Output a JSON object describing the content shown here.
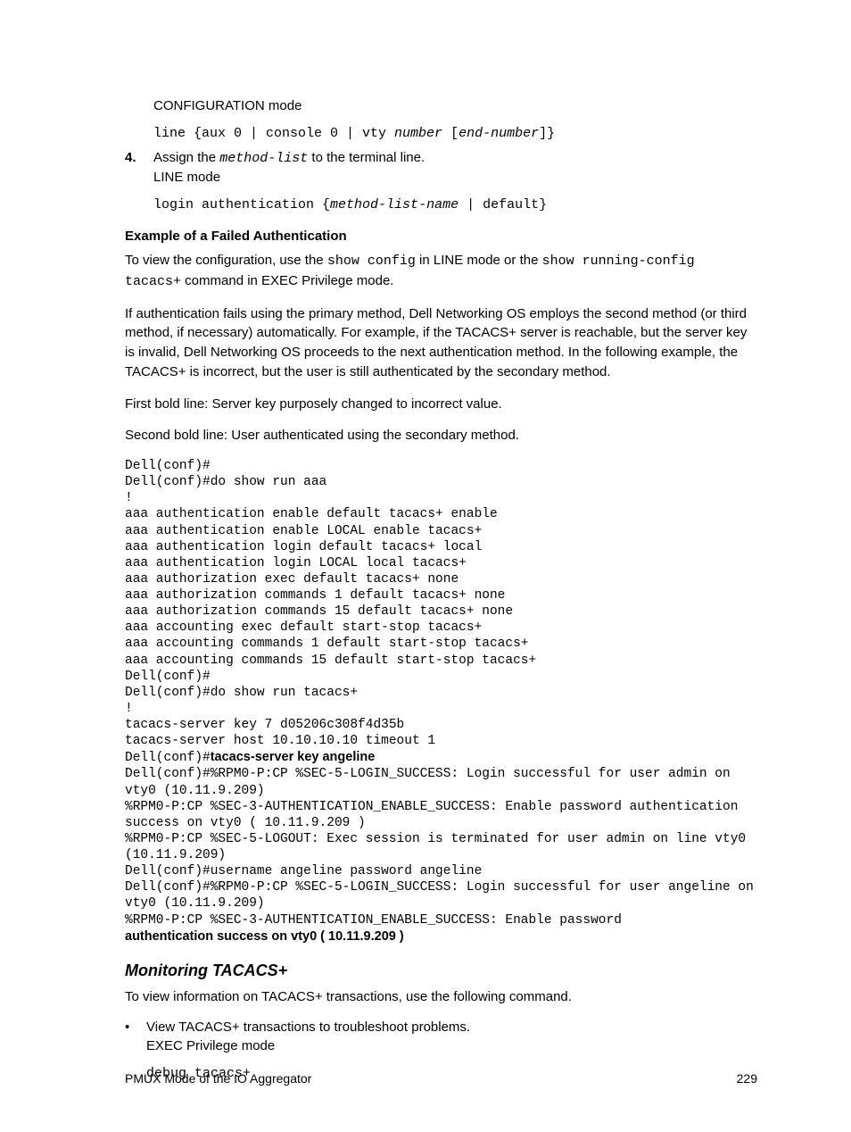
{
  "step3": {
    "mode": "CONFIGURATION mode",
    "code_pre": "line {aux 0 | console 0 | vty ",
    "code_italic1": "number",
    "code_mid": " [",
    "code_italic2": "end-number",
    "code_post": "]}"
  },
  "step4": {
    "num": "4.",
    "text_pre": "Assign the ",
    "text_code": "method-list",
    "text_post": " to the terminal line.",
    "mode": "LINE mode",
    "code_pre": "login authentication {",
    "code_italic": "method-list-name",
    "code_post": " | default}"
  },
  "example_heading": "Example of a Failed Authentication",
  "para1_pre": "To view the configuration, use the ",
  "para1_code1": "show config",
  "para1_mid": " in LINE mode or the ",
  "para1_code2": "show running-config tacacs+",
  "para1_post": " command in EXEC Privilege mode.",
  "para2": "If authentication fails using the primary method, Dell Networking OS employs the second method (or third method, if necessary) automatically. For example, if the TACACS+ server is reachable, but the server key is invalid, Dell Networking OS proceeds to the next authentication method. In the following example, the TACACS+ is incorrect, but the user is still authenticated by the secondary method.",
  "para3": "First bold line: Server key purposely changed to incorrect value.",
  "para4": "Second bold line: User authenticated using the secondary method.",
  "codeblock_a": "Dell(conf)#\nDell(conf)#do show run aaa\n!\naaa authentication enable default tacacs+ enable\naaa authentication enable LOCAL enable tacacs+\naaa authentication login default tacacs+ local\naaa authentication login LOCAL local tacacs+\naaa authorization exec default tacacs+ none\naaa authorization commands 1 default tacacs+ none\naaa authorization commands 15 default tacacs+ none\naaa accounting exec default start-stop tacacs+\naaa accounting commands 1 default start-stop tacacs+\naaa accounting commands 15 default start-stop tacacs+\nDell(conf)#\nDell(conf)#do show run tacacs+\n!\ntacacs-server key 7 d05206c308f4d35b\ntacacs-server host 10.10.10.10 timeout 1\nDell(conf)#",
  "bold1": "tacacs-server key angeline",
  "codeblock_b": "Dell(conf)#%RPM0-P:CP %SEC-5-LOGIN_SUCCESS: Login successful for user admin on vty0 (10.11.9.209)\n%RPM0-P:CP %SEC-3-AUTHENTICATION_ENABLE_SUCCESS: Enable password authentication success on vty0 ( 10.11.9.209 )\n%RPM0-P:CP %SEC-5-LOGOUT: Exec session is terminated for user admin on line vty0 (10.11.9.209)\nDell(conf)#username angeline password angeline\nDell(conf)#%RPM0-P:CP %SEC-5-LOGIN_SUCCESS: Login successful for user angeline on vty0 (10.11.9.209)\n%RPM0-P:CP %SEC-3-AUTHENTICATION_ENABLE_SUCCESS: Enable password ",
  "bold2": "authentication success on vty0 ( 10.11.9.209 )",
  "monitoring_heading": "Monitoring TACACS+",
  "para5": "To view information on TACACS+ transactions, use the following command.",
  "bullet1": "View TACACS+ transactions to troubleshoot problems.",
  "bullet1_mode": "EXEC Privilege mode",
  "bullet1_code": "debug tacacs+",
  "footer_left": "PMUX Mode of the IO Aggregator",
  "footer_right": "229"
}
